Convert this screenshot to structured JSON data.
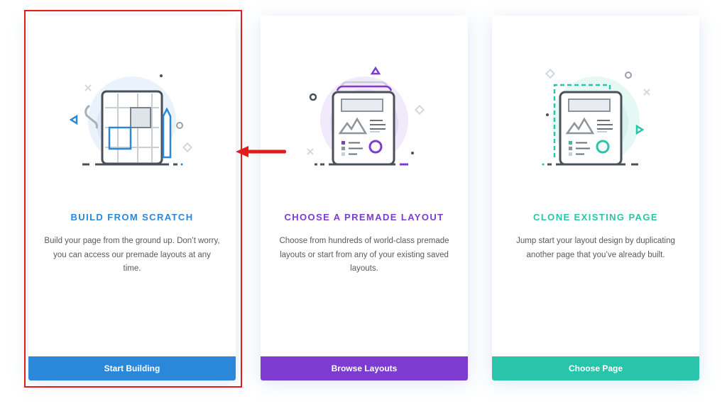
{
  "cards": [
    {
      "title": "BUILD FROM SCRATCH",
      "description": "Build your page from the ground up. Don’t worry, you can access our premade layouts at any time.",
      "button_label": "Start Building",
      "accent_color": "#2b87da",
      "icon": "grid-blueprint-icon",
      "highlighted": true
    },
    {
      "title": "CHOOSE A PREMADE LAYOUT",
      "description": "Choose from hundreds of world-class premade layouts or start from any of your existing saved layouts.",
      "button_label": "Browse Layouts",
      "accent_color": "#7e3bd0",
      "icon": "layout-document-icon",
      "highlighted": false
    },
    {
      "title": "CLONE EXISTING PAGE",
      "description": "Jump start your layout design by duplicating another page that you’ve already built.",
      "button_label": "Choose Page",
      "accent_color": "#29c4a9",
      "icon": "clone-document-icon",
      "highlighted": false
    }
  ],
  "annotation": {
    "highlight_color": "#e21b1b",
    "arrow_icon": "red-arrow-left-icon"
  }
}
